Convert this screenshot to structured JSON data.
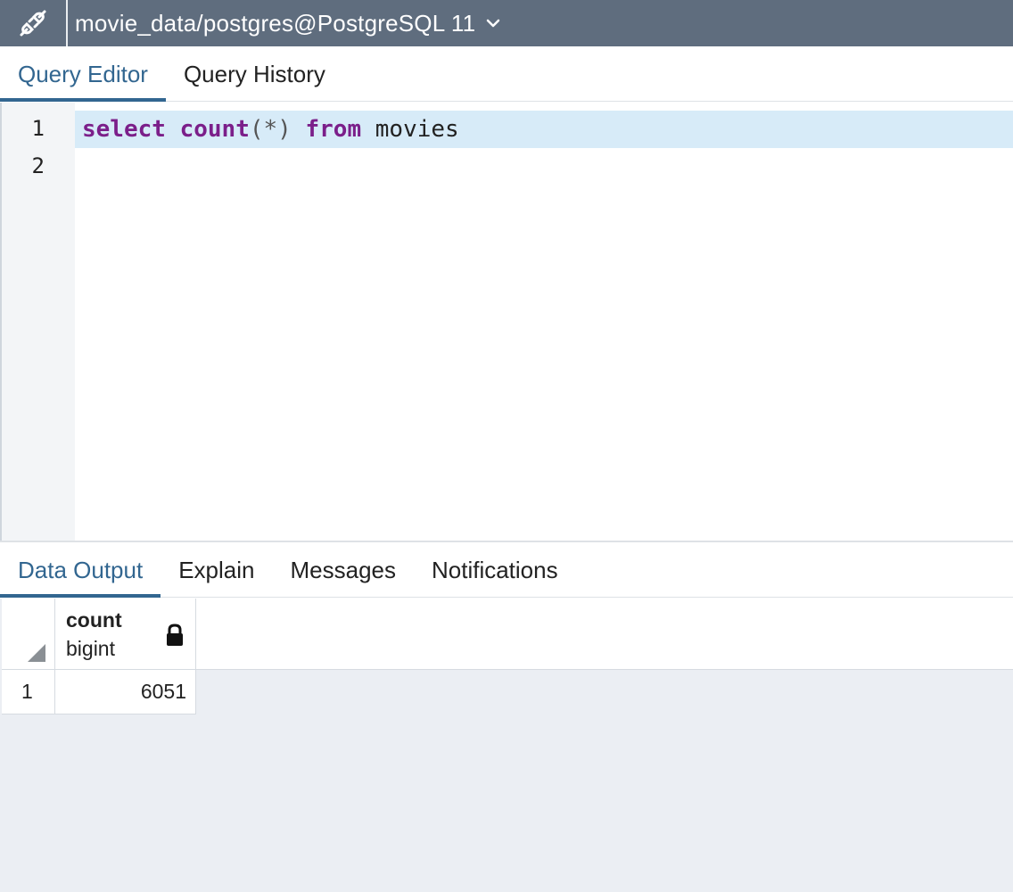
{
  "connection": {
    "title": "movie_data/postgres@PostgreSQL 11",
    "icon": "connection-plug-icon",
    "dropdown_icon": "chevron-down-icon"
  },
  "editor_tabs": [
    {
      "label": "Query Editor",
      "active": true
    },
    {
      "label": "Query History",
      "active": false
    }
  ],
  "editor": {
    "line_numbers": [
      "1",
      "2"
    ],
    "code_tokens": {
      "kw1": "select",
      "fn": "count",
      "open": "(",
      "star": "*",
      "close": ")",
      "kw2": "from",
      "table": "movies"
    }
  },
  "output_tabs": [
    {
      "label": "Data Output",
      "active": true
    },
    {
      "label": "Explain",
      "active": false
    },
    {
      "label": "Messages",
      "active": false
    },
    {
      "label": "Notifications",
      "active": false
    }
  ],
  "results": {
    "columns": [
      {
        "name": "count",
        "type": "bigint",
        "locked": true
      }
    ],
    "rows": [
      {
        "row_number": "1",
        "values": [
          "6051"
        ]
      }
    ]
  },
  "colors": {
    "topbar": "#5f6d7e",
    "accent": "#326690",
    "keyword": "#7b1f8a",
    "current_line": "#d7ebf8",
    "grid_background": "#ebeef3"
  }
}
